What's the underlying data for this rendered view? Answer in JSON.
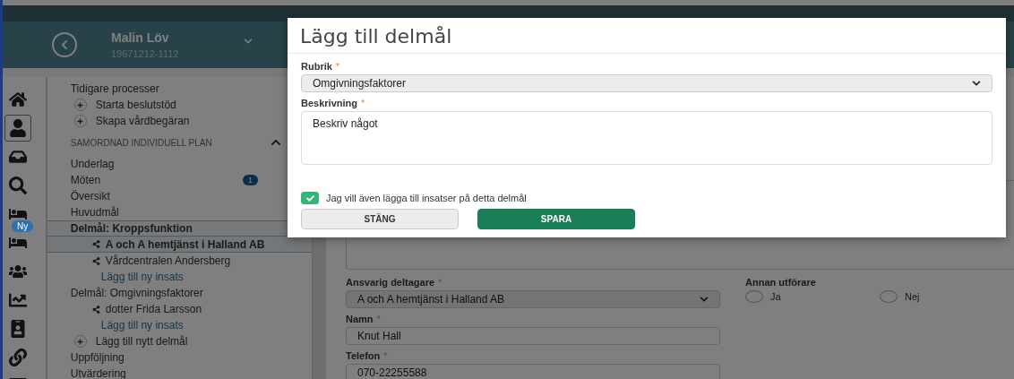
{
  "header": {
    "name": "Malin Löv",
    "id": "19671212-1112"
  },
  "rail": [
    {
      "selected": false
    },
    {
      "selected": true
    },
    {
      "selected": false
    },
    {
      "selected": false
    },
    {
      "selected": false
    },
    {
      "selected": false,
      "badge": "Ny"
    },
    {
      "selected": false
    },
    {
      "selected": false
    },
    {
      "selected": false
    },
    {
      "selected": false
    },
    {
      "selected": false
    }
  ],
  "nav": [
    {
      "kind": "heading",
      "label": "Tidigare processer"
    },
    {
      "kind": "action",
      "label": "Starta beslutstöd"
    },
    {
      "kind": "action",
      "label": "Skapa vårdbegäran"
    },
    {
      "kind": "section",
      "label": "SAMORDNAD INDIVIDUELL PLAN",
      "expanded": true
    },
    {
      "kind": "item",
      "label": "Underlag"
    },
    {
      "kind": "item",
      "label": "Möten",
      "badge": "1"
    },
    {
      "kind": "item",
      "label": "Översikt"
    },
    {
      "kind": "item",
      "label": "Huvudmål"
    },
    {
      "kind": "goal",
      "label": "Delmål: Kroppsfunktion",
      "selected": true,
      "children": [
        {
          "kind": "insats",
          "label": "A och A hemtjänst i Halland AB",
          "selected": true
        },
        {
          "kind": "insats",
          "label": "Vårdcentralen Andersberg",
          "selected": false
        },
        {
          "kind": "link",
          "label": "Lägg till ny insats"
        }
      ]
    },
    {
      "kind": "goal",
      "label": "Delmål: Omgivningsfaktorer",
      "selected": false,
      "children": [
        {
          "kind": "insats",
          "label": "dotter Frida Larsson",
          "selected": false
        },
        {
          "kind": "link",
          "label": "Lägg till ny insats"
        }
      ]
    },
    {
      "kind": "action",
      "label": "Lägg till nytt delmål"
    },
    {
      "kind": "item",
      "label": "Uppföljning"
    },
    {
      "kind": "item",
      "label": "Utvärdering"
    }
  ],
  "form": {
    "fields": [
      {
        "kind": "select",
        "label": "Ansvarig deltagare",
        "required_mark": "*",
        "value": "A och A hemtjänst i Halland AB"
      },
      {
        "kind": "text",
        "label": "Namn",
        "required_mark": "*",
        "value": "Knut Hall"
      },
      {
        "kind": "text",
        "label": "Telefon",
        "required_mark": "*",
        "value": "070-22255588"
      }
    ],
    "other": {
      "label": "Annan utförare",
      "options": [
        {
          "label": "Ja",
          "selected": false
        },
        {
          "label": "Nej",
          "selected": false
        }
      ]
    }
  },
  "modal": {
    "title": "Lägg till delmål",
    "fields": [
      {
        "kind": "select",
        "label": "Rubrik",
        "required_mark": "*",
        "value": "Omgivningsfaktorer"
      },
      {
        "kind": "textarea",
        "label": "Beskrivning",
        "required_mark": "*",
        "value": "Beskriv något"
      }
    ],
    "checkbox": {
      "label": "Jag vill även lägga till insatser på detta delmål",
      "checked": true
    },
    "buttons": [
      {
        "label": "STÄNG",
        "kind": "secondary"
      },
      {
        "label": "SPARA",
        "kind": "primary"
      }
    ]
  }
}
